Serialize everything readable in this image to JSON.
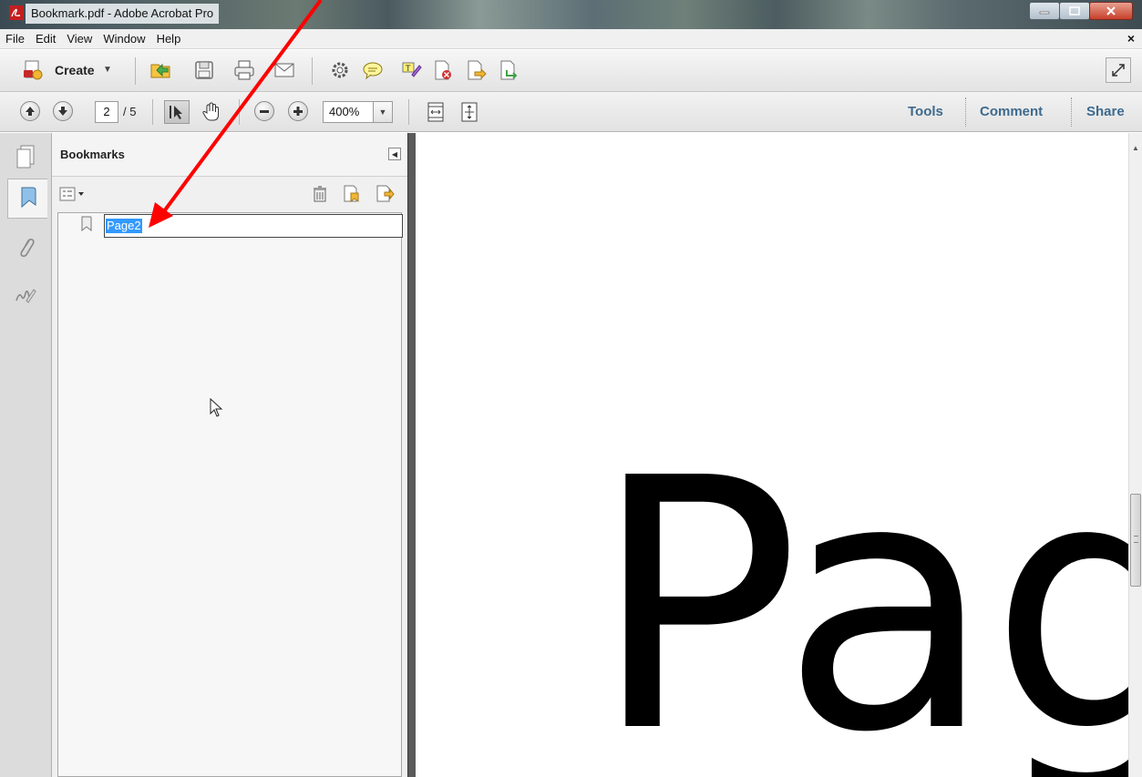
{
  "window": {
    "title": "Bookmark.pdf - Adobe Acrobat Pro",
    "controls": [
      "minimize-icon",
      "maximize-icon",
      "close-icon"
    ]
  },
  "menubar": {
    "items": [
      "File",
      "Edit",
      "View",
      "Window",
      "Help"
    ],
    "doc_close": "×"
  },
  "toolbar": {
    "create_label": "Create",
    "icons": [
      "create-pdf-icon",
      "open-icon",
      "save-icon",
      "print-icon",
      "email-icon",
      "settings-icon",
      "comment-icon",
      "highlight-icon",
      "reject-icon",
      "send-icon",
      "export-icon",
      "fullscreen-icon"
    ]
  },
  "navbar": {
    "current_page": "2",
    "total_pages": "/ 5",
    "zoom": "400%",
    "links": {
      "tools": "Tools",
      "comment": "Comment",
      "share": "Share"
    }
  },
  "sidebar": {
    "panel_title": "Bookmarks",
    "bookmarks": [
      {
        "label": "Page2",
        "editing": true,
        "selected": true
      }
    ]
  },
  "document": {
    "visible_text": "Pag"
  },
  "colors": {
    "accent_link": "#3d6a8e",
    "selection": "#3399ff",
    "annotation_arrow": "#ff0000"
  }
}
